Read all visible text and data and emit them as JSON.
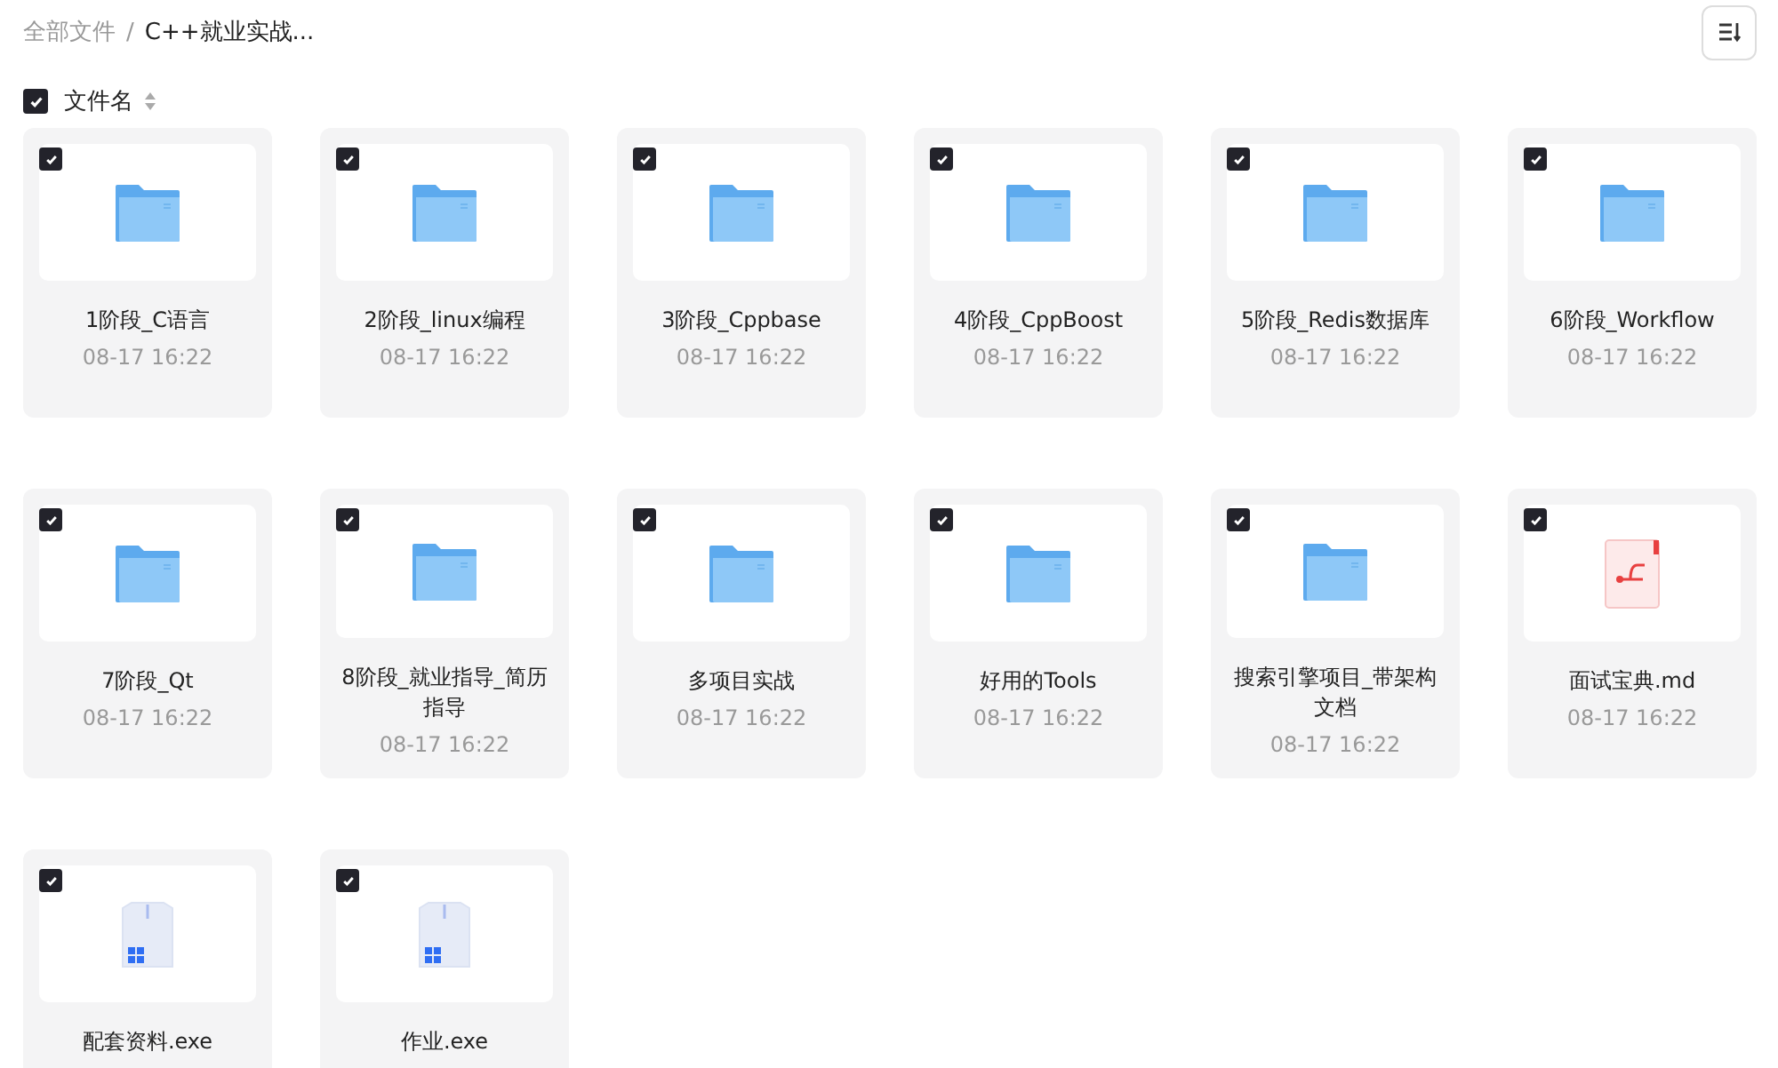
{
  "breadcrumb": [
    {
      "label": "全部文件",
      "current": false
    },
    {
      "separator": "/",
      "label": "C++就业实战...",
      "current": true
    }
  ],
  "header": {
    "label": "文件名",
    "checked": true
  },
  "files": [
    {
      "kind": "folder",
      "name": "1阶段_C语言",
      "date": "08-17 16:22",
      "checked": true
    },
    {
      "kind": "folder",
      "name": "2阶段_linux编程",
      "date": "08-17 16:22",
      "checked": true
    },
    {
      "kind": "folder",
      "name": "3阶段_Cppbase",
      "date": "08-17 16:22",
      "checked": true
    },
    {
      "kind": "folder",
      "name": "4阶段_CppBoost",
      "date": "08-17 16:22",
      "checked": true
    },
    {
      "kind": "folder",
      "name": "5阶段_Redis数据库",
      "date": "08-17 16:22",
      "checked": true
    },
    {
      "kind": "folder",
      "name": "6阶段_Workflow",
      "date": "08-17 16:22",
      "checked": true
    },
    {
      "kind": "folder",
      "name": "7阶段_Qt",
      "date": "08-17 16:22",
      "checked": true
    },
    {
      "kind": "folder",
      "name": "8阶段_就业指导_简历指导",
      "date": "08-17 16:22",
      "checked": true
    },
    {
      "kind": "folder",
      "name": "多项目实战",
      "date": "08-17 16:22",
      "checked": true
    },
    {
      "kind": "folder",
      "name": "好用的Tools",
      "date": "08-17 16:22",
      "checked": true
    },
    {
      "kind": "folder",
      "name": "搜索引擎项目_带架构文档",
      "date": "08-17 16:22",
      "checked": true
    },
    {
      "kind": "md",
      "name": "面试宝典.md",
      "date": "08-17 16:22",
      "checked": true
    },
    {
      "kind": "exe",
      "name": "配套资料.exe",
      "checked": true
    },
    {
      "kind": "exe",
      "name": "作业.exe",
      "checked": true
    }
  ]
}
